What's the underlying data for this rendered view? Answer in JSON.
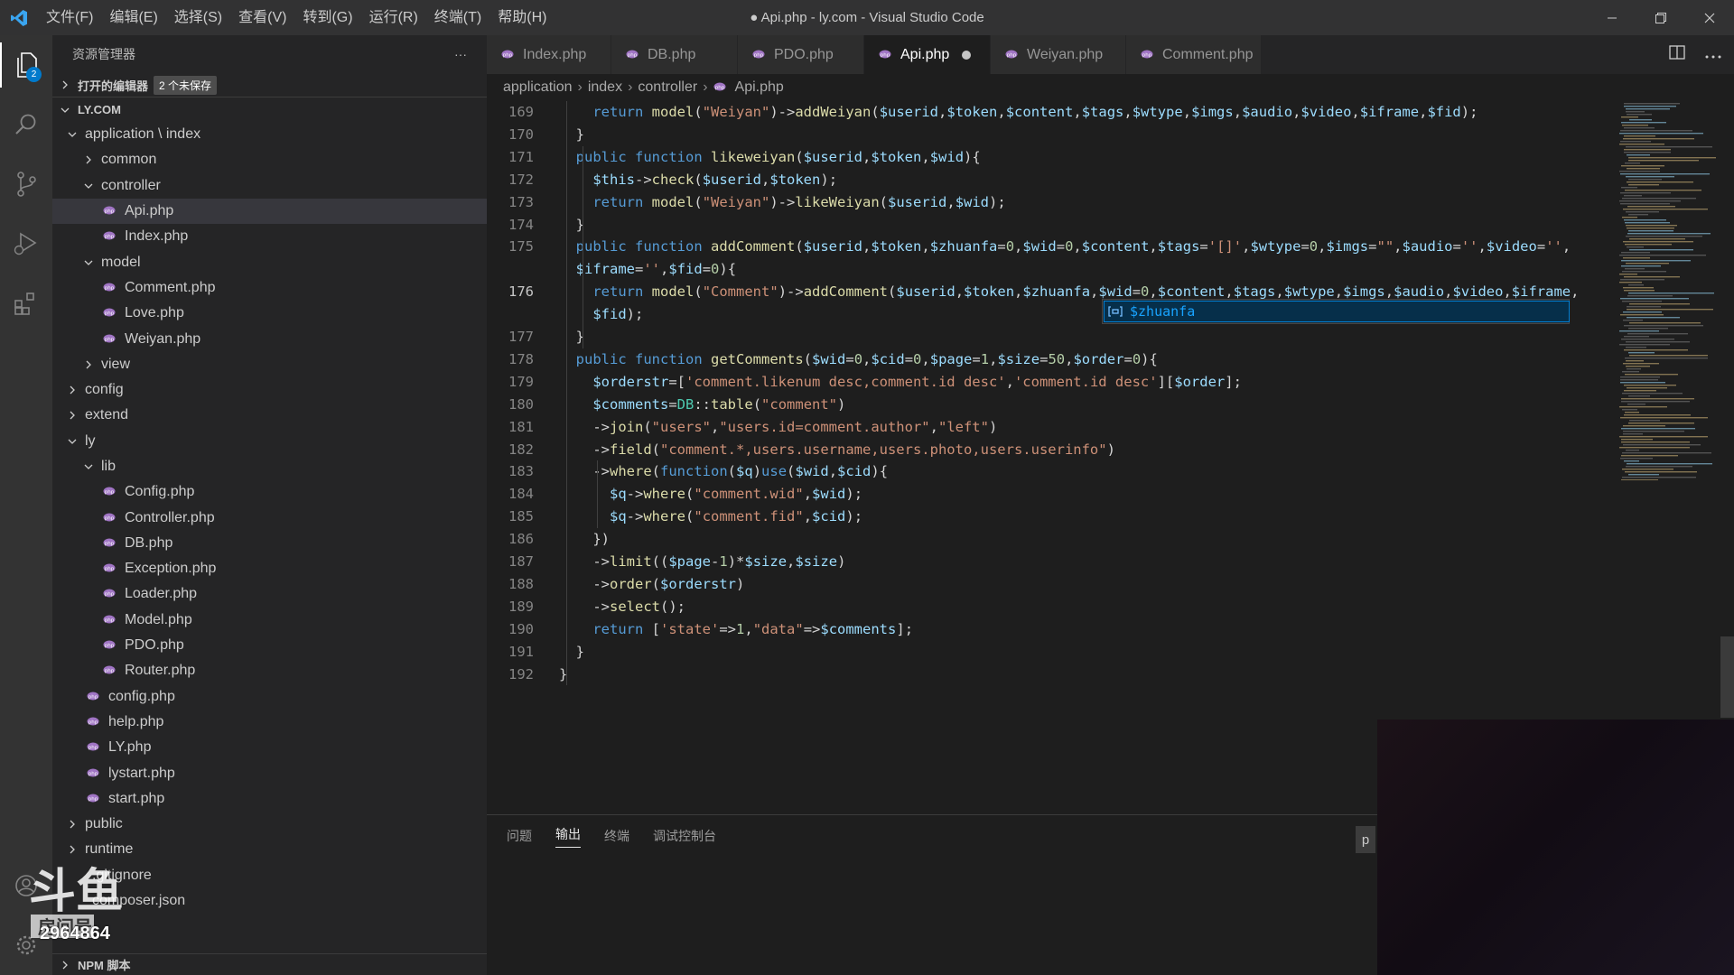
{
  "titlebar": {
    "menu": [
      "文件(F)",
      "编辑(E)",
      "选择(S)",
      "查看(V)",
      "转到(G)",
      "运行(R)",
      "终端(T)",
      "帮助(H)"
    ],
    "title": "● Api.php - ly.com - Visual Studio Code"
  },
  "activity": {
    "icons": [
      "files-icon",
      "search-icon",
      "source-control-icon",
      "run-debug-icon",
      "extensions-icon"
    ],
    "explorer_badge": "2"
  },
  "sidebar": {
    "header": "资源管理器",
    "more": "···",
    "open_editors": "打开的编辑器",
    "unsaved": "2 个未保存",
    "root": "LY.COM",
    "tree": [
      {
        "label": "application \\ index",
        "indent": 0,
        "kind": "folder-open"
      },
      {
        "label": "common",
        "indent": 1,
        "kind": "folder"
      },
      {
        "label": "controller",
        "indent": 1,
        "kind": "folder-open"
      },
      {
        "label": "Api.php",
        "indent": 2,
        "kind": "php",
        "selected": true
      },
      {
        "label": "Index.php",
        "indent": 2,
        "kind": "php"
      },
      {
        "label": "model",
        "indent": 1,
        "kind": "folder-open"
      },
      {
        "label": "Comment.php",
        "indent": 2,
        "kind": "php"
      },
      {
        "label": "Love.php",
        "indent": 2,
        "kind": "php"
      },
      {
        "label": "Weiyan.php",
        "indent": 2,
        "kind": "php"
      },
      {
        "label": "view",
        "indent": 1,
        "kind": "folder"
      },
      {
        "label": "config",
        "indent": 0,
        "kind": "folder"
      },
      {
        "label": "extend",
        "indent": 0,
        "kind": "folder"
      },
      {
        "label": "ly",
        "indent": 0,
        "kind": "folder-open"
      },
      {
        "label": "lib",
        "indent": 1,
        "kind": "folder-open"
      },
      {
        "label": "Config.php",
        "indent": 2,
        "kind": "php"
      },
      {
        "label": "Controller.php",
        "indent": 2,
        "kind": "php"
      },
      {
        "label": "DB.php",
        "indent": 2,
        "kind": "php"
      },
      {
        "label": "Exception.php",
        "indent": 2,
        "kind": "php"
      },
      {
        "label": "Loader.php",
        "indent": 2,
        "kind": "php"
      },
      {
        "label": "Model.php",
        "indent": 2,
        "kind": "php"
      },
      {
        "label": "PDO.php",
        "indent": 2,
        "kind": "php"
      },
      {
        "label": "Router.php",
        "indent": 2,
        "kind": "php"
      },
      {
        "label": "config.php",
        "indent": 1,
        "kind": "php"
      },
      {
        "label": "help.php",
        "indent": 1,
        "kind": "php"
      },
      {
        "label": "LY.php",
        "indent": 1,
        "kind": "php"
      },
      {
        "label": "lystart.php",
        "indent": 1,
        "kind": "php"
      },
      {
        "label": "start.php",
        "indent": 1,
        "kind": "php"
      },
      {
        "label": "public",
        "indent": 0,
        "kind": "folder"
      },
      {
        "label": "runtime",
        "indent": 0,
        "kind": "folder"
      },
      {
        "label": ".gitignore",
        "indent": 0,
        "kind": "file"
      },
      {
        "label": "composer.json",
        "indent": 0,
        "kind": "file"
      }
    ],
    "npm": "NPM 脚本"
  },
  "tabs": [
    {
      "label": "Index.php",
      "active": false,
      "dirty": false
    },
    {
      "label": "DB.php",
      "active": false,
      "dirty": false
    },
    {
      "label": "PDO.php",
      "active": false,
      "dirty": false
    },
    {
      "label": "Api.php",
      "active": true,
      "dirty": true
    },
    {
      "label": "Weiyan.php",
      "active": false,
      "dirty": true
    },
    {
      "label": "Comment.php",
      "active": false,
      "dirty": false
    }
  ],
  "breadcrumb": [
    "application",
    "index",
    "controller",
    "Api.php"
  ],
  "editor": {
    "current_line": "176",
    "lines": [
      {
        "n": "169",
        "t": "    return model(\"Weiyan\")->addWeiyan($userid,$token,$content,$tags,$wtype,$imgs,$audio,$video,$iframe,$fid);"
      },
      {
        "n": "170",
        "t": "  }"
      },
      {
        "n": "171",
        "t": "  public function likeweiyan($userid,$token,$wid){"
      },
      {
        "n": "172",
        "t": "    $this->check($userid,$token);"
      },
      {
        "n": "173",
        "t": "    return model(\"Weiyan\")->likeWeiyan($userid,$wid);"
      },
      {
        "n": "174",
        "t": "  }"
      },
      {
        "n": "175",
        "t": "  public function addComment($userid,$token,$zhuanfa=0,$wid=0,$content,$tags='[]',$wtype=0,$imgs=\"\",$audio='',$video='',"
      },
      {
        "n": "",
        "t": "  $iframe='',$fid=0){"
      },
      {
        "n": "176",
        "t": "    return model(\"Comment\")->addComment($userid,$token,$zhuanfa,$wid=0,$content,$tags,$wtype,$imgs,$audio,$video,$iframe,"
      },
      {
        "n": "",
        "t": "    $fid);"
      },
      {
        "n": "177",
        "t": "  }"
      },
      {
        "n": "178",
        "t": "  public function getComments($wid=0,$cid=0,$page=1,$size=50,$order=0){"
      },
      {
        "n": "179",
        "t": "    $orderstr=['comment.likenum desc,comment.id desc','comment.id desc'][$order];"
      },
      {
        "n": "180",
        "t": "    $comments=DB::table(\"comment\")"
      },
      {
        "n": "181",
        "t": "    ->join(\"users\",\"users.id=comment.author\",\"left\")"
      },
      {
        "n": "182",
        "t": "    ->field(\"comment.*,users.username,users.photo,users.userinfo\")"
      },
      {
        "n": "183",
        "t": "    ->where(function($q)use($wid,$cid){"
      },
      {
        "n": "184",
        "t": "      $q->where(\"comment.wid\",$wid);"
      },
      {
        "n": "185",
        "t": "      $q->where(\"comment.fid\",$cid);"
      },
      {
        "n": "186",
        "t": "    })"
      },
      {
        "n": "187",
        "t": "    ->limit(($page-1)*$size,$size)"
      },
      {
        "n": "188",
        "t": "    ->order($orderstr)"
      },
      {
        "n": "189",
        "t": "    ->select();"
      },
      {
        "n": "190",
        "t": "    return ['state'=>1,\"data\"=>$comments];"
      },
      {
        "n": "191",
        "t": "  }"
      },
      {
        "n": "192",
        "t": "}"
      }
    ],
    "suggestion": "$zhuanfa"
  },
  "panel": {
    "tabs": [
      "问题",
      "输出",
      "终端",
      "调试控制台"
    ],
    "active": "输出",
    "side_label": "p"
  },
  "watermark": {
    "number": "2964864"
  },
  "colors": {
    "accent": "#007acc",
    "php_icon": "#a074c4",
    "keyword": "#569cd6",
    "function": "#dcdcaa",
    "variable": "#9cdcfe",
    "string": "#ce9178"
  }
}
